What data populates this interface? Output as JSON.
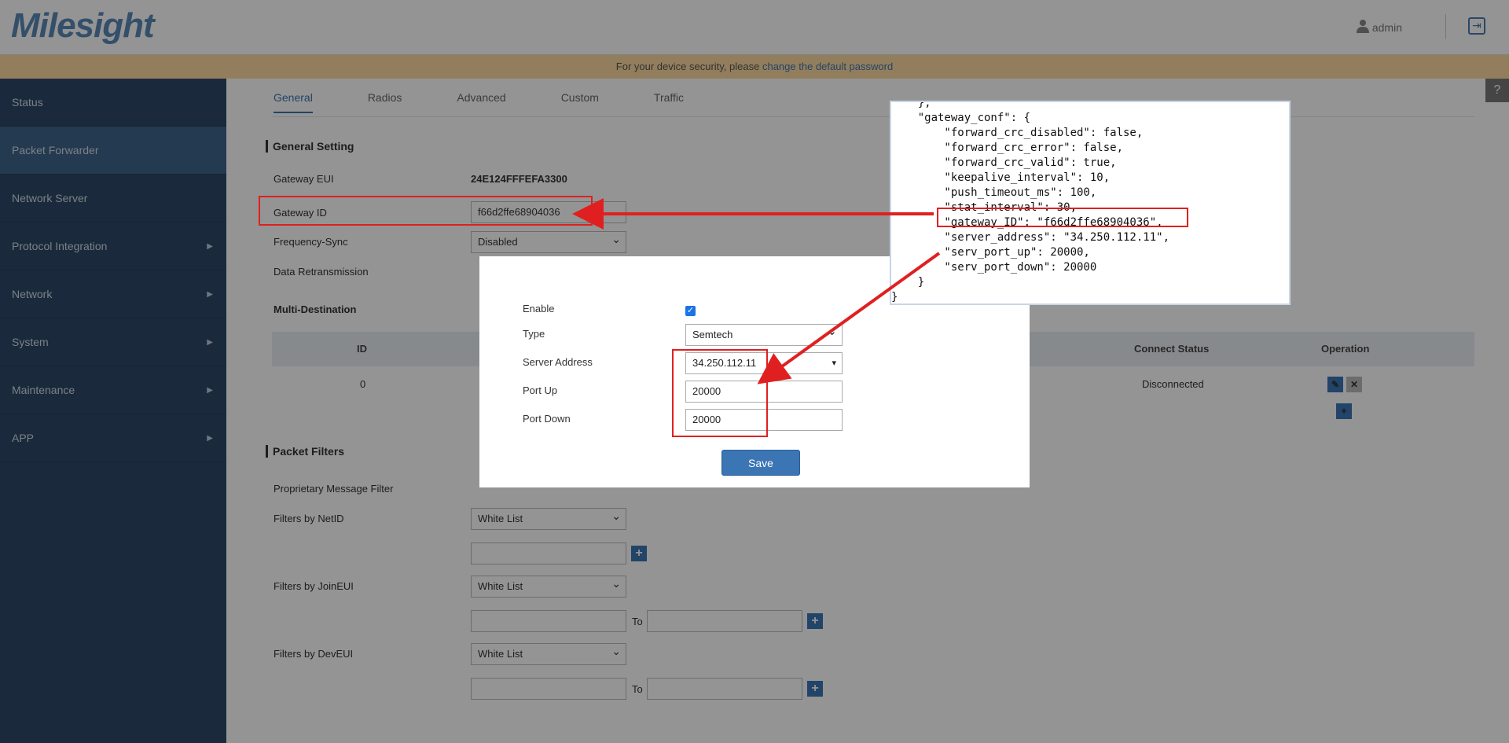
{
  "header": {
    "logo": "Milesight",
    "user": "admin"
  },
  "banner": {
    "text": "For your device security, please",
    "link": "change the default password"
  },
  "sidebar": {
    "items": [
      {
        "label": "Status"
      },
      {
        "label": "Packet Forwarder"
      },
      {
        "label": "Network Server"
      },
      {
        "label": "Protocol Integration"
      },
      {
        "label": "Network"
      },
      {
        "label": "System"
      },
      {
        "label": "Maintenance"
      },
      {
        "label": "APP"
      }
    ]
  },
  "tabs": [
    "General",
    "Radios",
    "Advanced",
    "Custom",
    "Traffic"
  ],
  "general": {
    "section_title": "General Setting",
    "gateway_eui_label": "Gateway EUI",
    "gateway_eui": "24E124FFFEFA3300",
    "gateway_id_label": "Gateway ID",
    "gateway_id": "f66d2ffe68904036",
    "freq_sync_label": "Frequency-Sync",
    "freq_sync": "Disabled",
    "data_retrans_label": "Data Retransmission",
    "multi_dest_label": "Multi-Destination"
  },
  "multi_dest_table": {
    "headers": {
      "id": "ID",
      "connect_status": "Connect Status",
      "operation": "Operation"
    },
    "row": {
      "id": "0",
      "status": "Disconnected"
    }
  },
  "packet_filters": {
    "section_title": "Packet Filters",
    "proprietary_label": "Proprietary Message Filter",
    "netid_label": "Filters by NetID",
    "netid_select": "White List",
    "joineui_label": "Filters by JoinEUI",
    "joineui_select": "White List",
    "deveui_label": "Filters by DevEUI",
    "deveui_select": "White List",
    "to_label": "To"
  },
  "modal": {
    "enable_label": "Enable",
    "type_label": "Type",
    "type_value": "Semtech",
    "server_label": "Server Address",
    "server_value": "34.250.112.11",
    "port_up_label": "Port Up",
    "port_up_value": "20000",
    "port_down_label": "Port Down",
    "port_down_value": "20000",
    "save_label": "Save"
  },
  "code_snippet": "    },\n    \"gateway_conf\": {\n        \"forward_crc_disabled\": false,\n        \"forward_crc_error\": false,\n        \"forward_crc_valid\": true,\n        \"keepalive_interval\": 10,\n        \"push_timeout_ms\": 100,\n        \"stat_interval\": 30,\n        \"gateway_ID\": \"f66d2ffe68904036\",\n        \"server_address\": \"34.250.112.11\",\n        \"serv_port_up\": 20000,\n        \"serv_port_down\": 20000\n    }\n}",
  "colors": {
    "sidebar_bg": "#2d4968",
    "accent": "#3b75b4",
    "annotation_red": "#e02020",
    "banner_bg": "#fcd9a0"
  }
}
